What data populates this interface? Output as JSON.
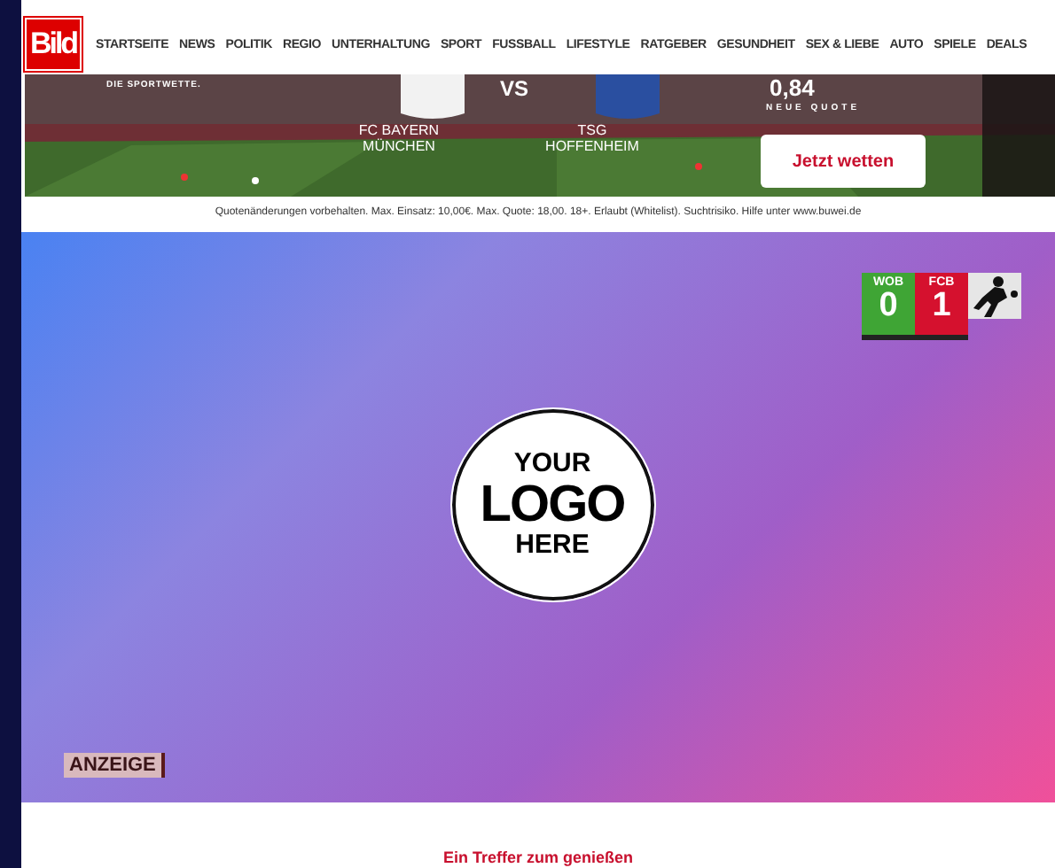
{
  "nav": {
    "logo": "Bild",
    "items": [
      "STARTSEITE",
      "NEWS",
      "POLITIK",
      "REGIO",
      "UNTERHALTUNG",
      "SPORT",
      "FUSSBALL",
      "LIFESTYLE",
      "RATGEBER",
      "GESUNDHEIT",
      "SEX & LIEBE",
      "AUTO",
      "SPIELE",
      "DEALS"
    ]
  },
  "ad_banner": {
    "tagline": "DIE SPORTWETTE.",
    "home_team": "FC BAYERN MÜNCHEN",
    "versus": "VS",
    "away_team": "TSG HOFFENHEIM",
    "odds": "0,84",
    "odds_label": "NEUE QUOTE",
    "button": "Jetzt wetten"
  },
  "disclaimer": "Quotenänderungen vorbehalten. Max. Einsatz: 10,00€. Max. Quote: 18,00. 18+. Erlaubt (Whitelist). Suchtrisiko. Hilfe unter www.buwei.de",
  "video": {
    "score": [
      {
        "team": "WOB",
        "goals": "0",
        "color": "#3fa535"
      },
      {
        "team": "FCB",
        "goals": "1",
        "color": "#d5112e"
      }
    ],
    "logo": [
      "YOUR",
      "LOGO",
      "HERE"
    ],
    "ad_label": "ANZEIGE"
  },
  "headline": "Ein Treffer zum genießen"
}
